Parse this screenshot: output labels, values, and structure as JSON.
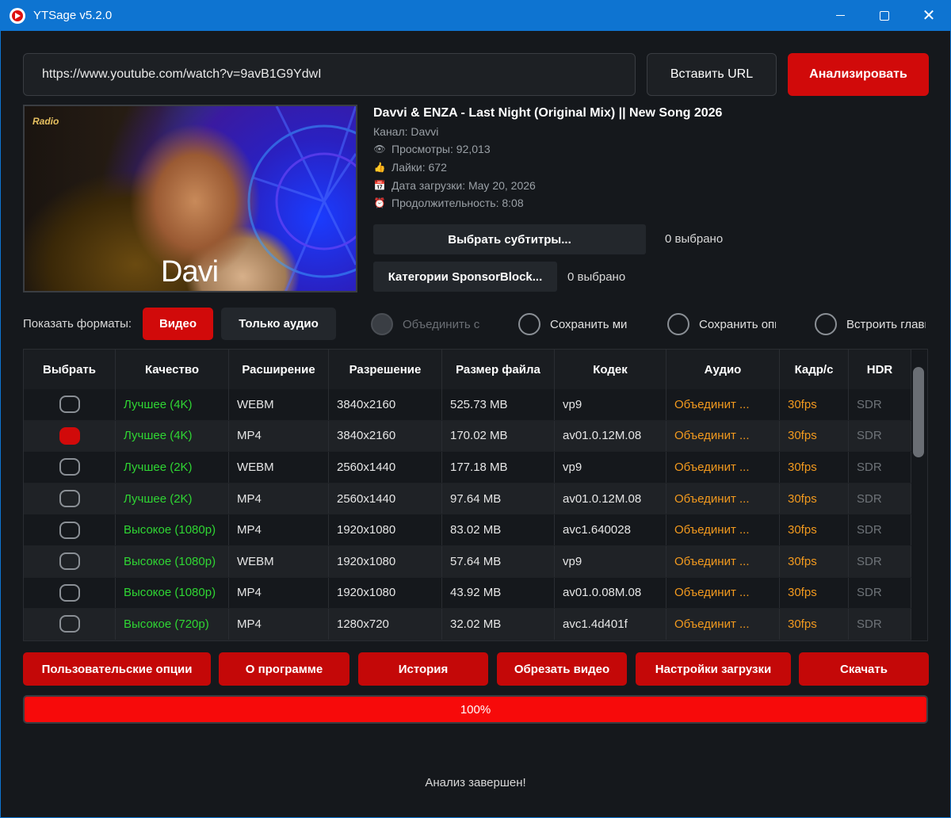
{
  "window": {
    "title": "YTSage  v5.2.0"
  },
  "url_bar": {
    "value": "https://www.youtube.com/watch?v=9avB1G9YdwI",
    "paste_label": "Вставить URL",
    "analyze_label": "Анализировать"
  },
  "thumbnail": {
    "logo_text": "Radio",
    "brand_text": "Davi"
  },
  "video": {
    "title": "Davvi & ENZA - Last Night (Original Mix) || New Song 2026",
    "channel": "Канал: Davvi",
    "views": "Просмотры: 92,013",
    "likes": "Лайки: 672",
    "upload_date": "Дата загрузки: May 20, 2026",
    "duration": "Продолжительность: 8:08"
  },
  "subtitles": {
    "button": "Выбрать субтитры...",
    "count": "0 выбрано"
  },
  "sponsorblock": {
    "button": "Категории SponsorBlock...",
    "count": "0 выбрано"
  },
  "formats": {
    "label": "Показать форматы:",
    "video_label": "Видео",
    "audio_label": "Только аудио",
    "options": [
      {
        "label": "Объединить с",
        "disabled": true
      },
      {
        "label": "Сохранить миниатюру",
        "disabled": false
      },
      {
        "label": "Сохранить описание",
        "disabled": false
      },
      {
        "label": "Встроить главы",
        "disabled": false
      }
    ]
  },
  "table": {
    "headers": [
      "Выбрать",
      "Качество",
      "Расширение",
      "Разрешение",
      "Размер файла",
      "Кодек",
      "Аудио",
      "Кадр/с",
      "HDR"
    ],
    "rows": [
      {
        "selected": false,
        "quality": "Лучшее (4K)",
        "ext": "WEBM",
        "res": "3840x2160",
        "size": "525.73 MB",
        "codec": "vp9",
        "audio": "Объединит ...",
        "fps": "30fps",
        "hdr": "SDR"
      },
      {
        "selected": true,
        "quality": "Лучшее (4K)",
        "ext": "MP4",
        "res": "3840x2160",
        "size": "170.02 MB",
        "codec": "av01.0.12M.08",
        "audio": "Объединит ...",
        "fps": "30fps",
        "hdr": "SDR"
      },
      {
        "selected": false,
        "quality": "Лучшее (2K)",
        "ext": "WEBM",
        "res": "2560x1440",
        "size": "177.18 MB",
        "codec": "vp9",
        "audio": "Объединит ...",
        "fps": "30fps",
        "hdr": "SDR"
      },
      {
        "selected": false,
        "quality": "Лучшее (2K)",
        "ext": "MP4",
        "res": "2560x1440",
        "size": "97.64 MB",
        "codec": "av01.0.12M.08",
        "audio": "Объединит ...",
        "fps": "30fps",
        "hdr": "SDR"
      },
      {
        "selected": false,
        "quality": "Высокое (1080p)",
        "ext": "MP4",
        "res": "1920x1080",
        "size": "83.02 MB",
        "codec": "avc1.640028",
        "audio": "Объединит ...",
        "fps": "30fps",
        "hdr": "SDR"
      },
      {
        "selected": false,
        "quality": "Высокое (1080p)",
        "ext": "WEBM",
        "res": "1920x1080",
        "size": "57.64 MB",
        "codec": "vp9",
        "audio": "Объединит ...",
        "fps": "30fps",
        "hdr": "SDR"
      },
      {
        "selected": false,
        "quality": "Высокое (1080p)",
        "ext": "MP4",
        "res": "1920x1080",
        "size": "43.92 MB",
        "codec": "av01.0.08M.08",
        "audio": "Объединит ...",
        "fps": "30fps",
        "hdr": "SDR"
      },
      {
        "selected": false,
        "quality": "Высокое (720p)",
        "ext": "MP4",
        "res": "1280x720",
        "size": "32.02 MB",
        "codec": "avc1.4d401f",
        "audio": "Объединит ...",
        "fps": "30fps",
        "hdr": "SDR"
      }
    ]
  },
  "actions": {
    "custom": "Пользовательские опции",
    "about": "О программе",
    "history": "История",
    "trim": "Обрезать видео",
    "settings": "Настройки загрузки",
    "download": "Скачать"
  },
  "progress": {
    "value": 100,
    "text": "100%"
  },
  "status": "Анализ завершен!",
  "colors": {
    "accent_red": "#d10a0a",
    "progress_red": "#f70a0a",
    "titlebar_blue": "#0e74d1",
    "quality_green": "#2fd633",
    "audio_orange": "#f39a1e"
  },
  "icons": {
    "views": "eye-icon",
    "likes": "thumbs-up-icon",
    "date": "calendar-icon",
    "duration": "clock-icon"
  }
}
